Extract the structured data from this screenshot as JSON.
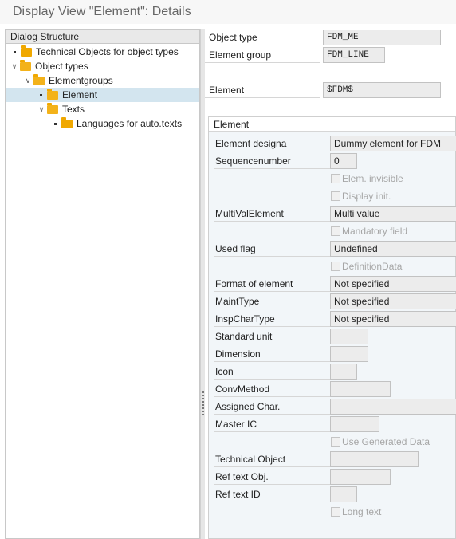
{
  "window": {
    "title": "Display View \"Element\": Details"
  },
  "tree": {
    "header": "Dialog Structure",
    "items": [
      {
        "label": "Technical Objects for object types"
      },
      {
        "label": "Object types"
      },
      {
        "label": "Elementgroups"
      },
      {
        "label": "Element"
      },
      {
        "label": "Texts"
      },
      {
        "label": "Languages for auto.texts"
      }
    ]
  },
  "header_fields": {
    "object_type": {
      "label": "Object type",
      "value": "FDM_ME"
    },
    "element_group": {
      "label": "Element group",
      "value": "FDM_LINE"
    },
    "element": {
      "label": "Element",
      "value": "$FDM$"
    }
  },
  "group": {
    "title": "Element",
    "element_designa": {
      "label": "Element designa",
      "value": "Dummy element for FDM"
    },
    "sequencenumber": {
      "label": "Sequencenumber",
      "value": "0"
    },
    "elem_invisible": {
      "label": "Elem. invisible"
    },
    "display_init": {
      "label": "Display init."
    },
    "multivalelement": {
      "label": "MultiValElement",
      "value": "Multi value"
    },
    "mandatory_field": {
      "label": "Mandatory field"
    },
    "used_flag": {
      "label": "Used flag",
      "value": "Undefined"
    },
    "definitiondata": {
      "label": "DefinitionData"
    },
    "format_of_element": {
      "label": "Format of element",
      "value": "Not specified"
    },
    "mainttype": {
      "label": "MaintType",
      "value": "Not specified"
    },
    "inspchartype": {
      "label": "InspCharType",
      "value": "Not specified"
    },
    "standard_unit": {
      "label": "Standard unit"
    },
    "dimension": {
      "label": "Dimension"
    },
    "icon": {
      "label": "Icon"
    },
    "convmethod": {
      "label": "ConvMethod"
    },
    "assigned_char": {
      "label": "Assigned Char."
    },
    "master_ic": {
      "label": "Master IC"
    },
    "use_generated_data": {
      "label": "Use Generated Data"
    },
    "technical_object": {
      "label": "Technical Object"
    },
    "ref_text_obj": {
      "label": "Ref text Obj."
    },
    "ref_text_id": {
      "label": "Ref text ID"
    },
    "long_text": {
      "label": "Long text"
    }
  }
}
